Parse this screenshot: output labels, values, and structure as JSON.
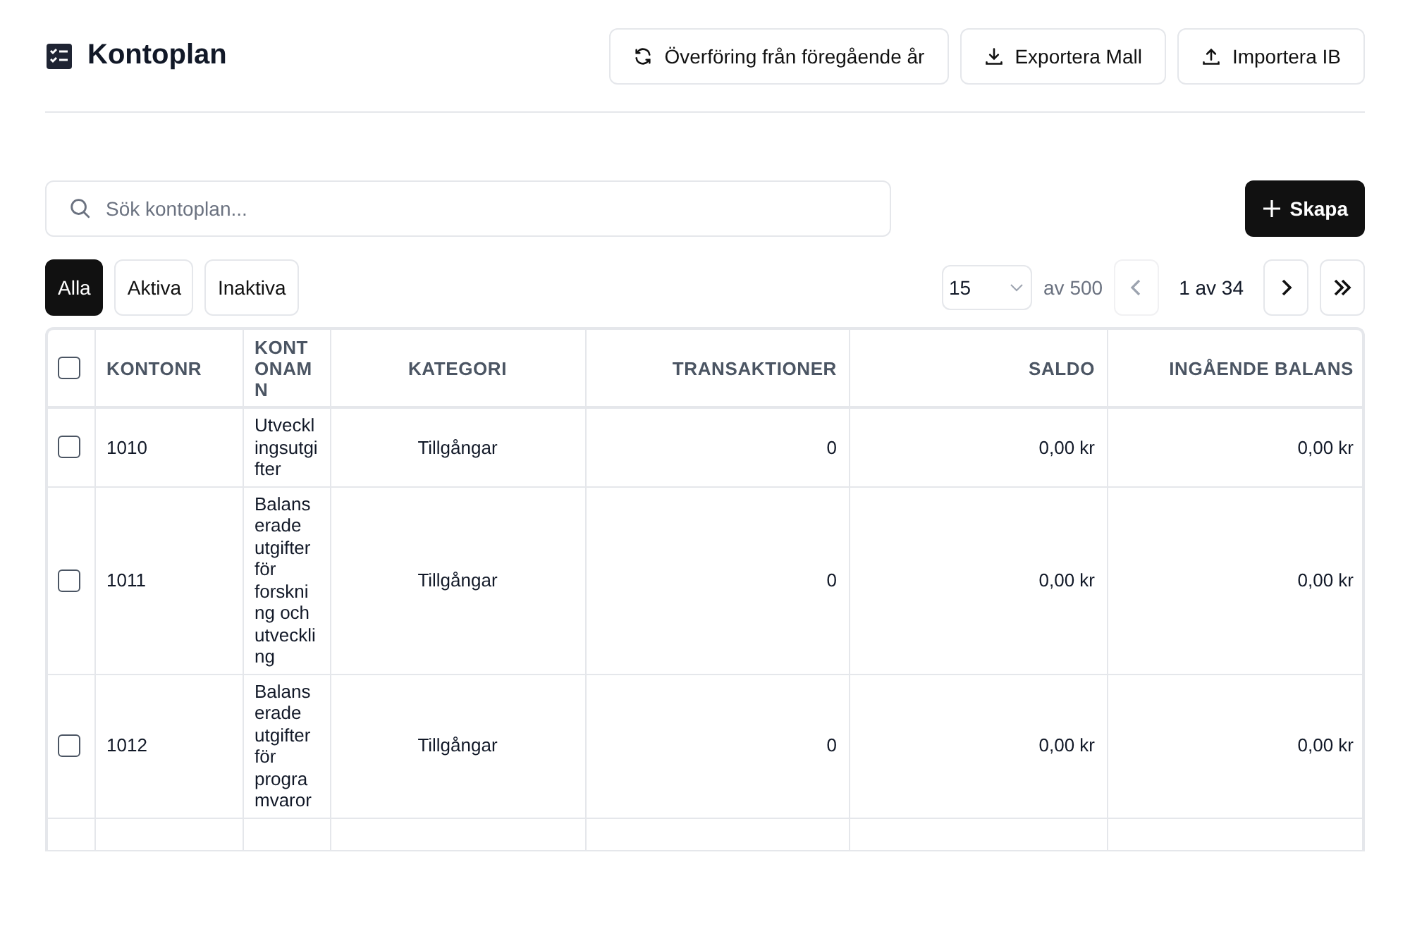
{
  "header": {
    "title": "Kontoplan",
    "actions": [
      {
        "kind": "transfer",
        "label": "Överföring från föregående år"
      },
      {
        "kind": "export",
        "label": "Exportera Mall"
      },
      {
        "kind": "import",
        "label": "Importera IB"
      }
    ]
  },
  "search": {
    "placeholder": "Sök kontoplan..."
  },
  "create_button": {
    "label": "Skapa"
  },
  "filters": [
    {
      "label": "Alla",
      "selected": true
    },
    {
      "label": "Aktiva",
      "selected": false
    },
    {
      "label": "Inaktiva",
      "selected": false
    }
  ],
  "pagination": {
    "page_size": "15",
    "total": "av 500",
    "page": "1 av 34",
    "prev_disabled": true,
    "next_disabled": false
  },
  "table": {
    "select_all": {
      "checked": false
    },
    "columns": [
      {
        "label": "KONTONR"
      },
      {
        "label": "KONTONAMN"
      },
      {
        "label": "KATEGORI"
      },
      {
        "label": "TRANSAKTIONER"
      },
      {
        "label": "SALDO"
      },
      {
        "label": "INGÅENDE BALANS"
      }
    ],
    "rows": [
      {
        "checked": false,
        "cells": [
          "1010",
          "Utvecklingsutgifter",
          "Tillgångar",
          "0",
          "0,00 kr",
          "0,00 kr"
        ]
      },
      {
        "checked": false,
        "cells": [
          "1011",
          "Balanserade utgifter för forskning och utveckling",
          "Tillgångar",
          "0",
          "0,00 kr",
          "0,00 kr"
        ]
      },
      {
        "checked": false,
        "cells": [
          "1012",
          "Balanserade utgifter för programvaror",
          "Tillgångar",
          "0",
          "0,00 kr",
          "0,00 kr"
        ]
      }
    ]
  }
}
